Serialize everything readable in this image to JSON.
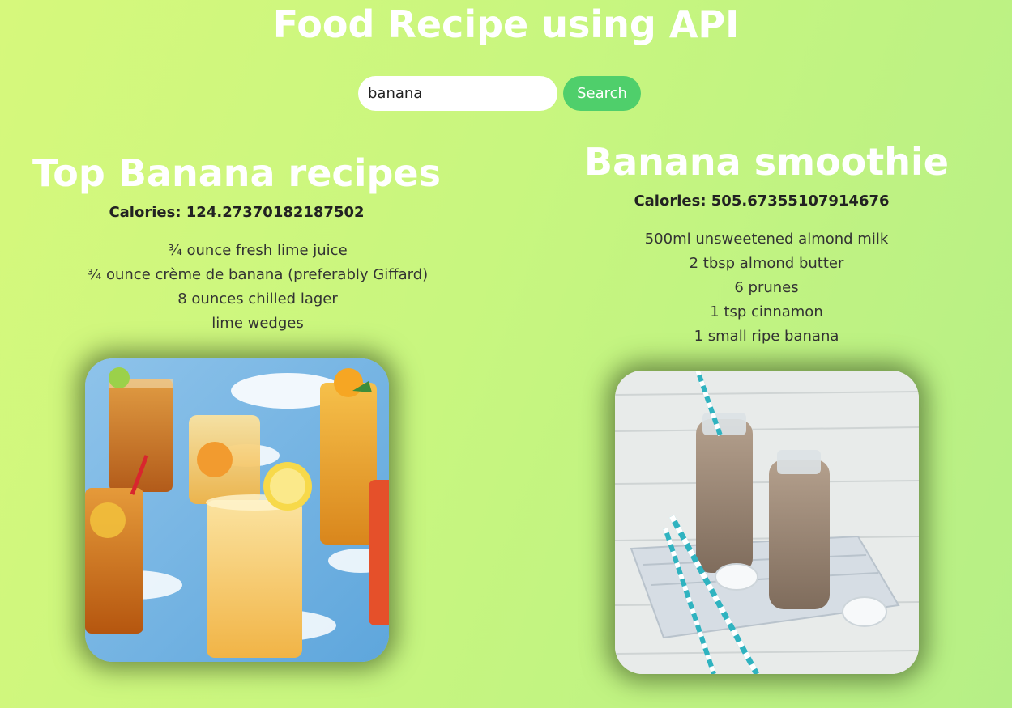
{
  "header": {
    "title": "Food Recipe using API"
  },
  "search": {
    "value": "banana",
    "button_label": "Search"
  },
  "recipes": [
    {
      "title": "Top Banana recipes",
      "calories": "Calories: 124.27370182187502",
      "ingredients": [
        "¾ ounce fresh lime juice",
        "¾ ounce crème de banana (preferably Giffard)",
        "8 ounces chilled lager",
        "lime wedges"
      ],
      "image": "iced-drinks-photo"
    },
    {
      "title": "Banana smoothie",
      "calories": "Calories: 505.67355107914676",
      "ingredients": [
        "500ml unsweetened almond milk",
        "2 tbsp almond butter",
        "6 prunes",
        "1 tsp cinnamon",
        "1 small ripe banana"
      ],
      "image": "smoothie-bottles-photo"
    }
  ],
  "colors": {
    "background_start": "#d6f87c",
    "background_end": "#b6ef86",
    "button": "#4fcf6b",
    "title": "#ffffff"
  }
}
